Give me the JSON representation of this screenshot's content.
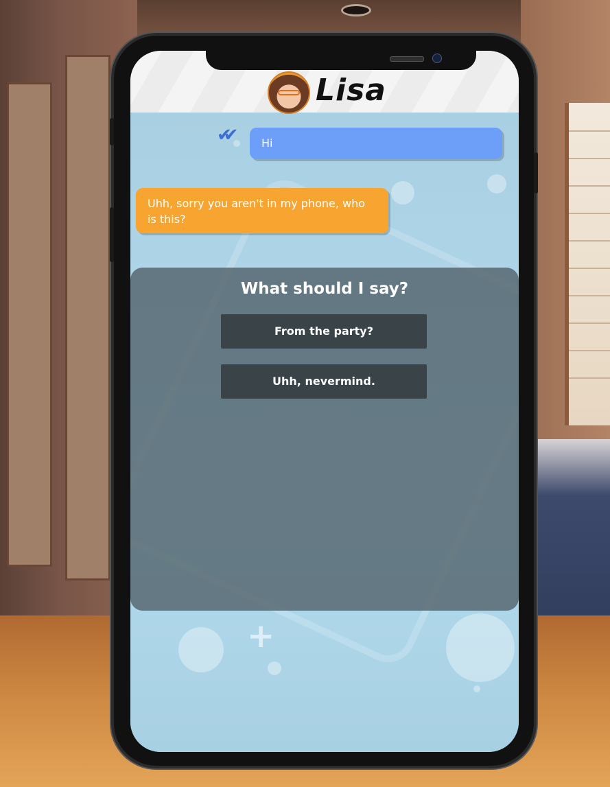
{
  "contact": {
    "name": "Lisa"
  },
  "messages": [
    {
      "from": "player",
      "text": "Hi",
      "status": "read"
    },
    {
      "from": "contact",
      "text": "Uhh, sorry you aren't in my phone, who is this?"
    }
  ],
  "choices": {
    "prompt": "What should I say?",
    "options": [
      "From the party?",
      "Uhh, nevermind."
    ]
  },
  "icons": {
    "read_receipt": "double-check-icon",
    "avatar": "lisa-avatar"
  },
  "colors": {
    "outgoing_bubble": "#6d9ef8",
    "incoming_bubble": "#f7a530",
    "choice_panel": "#46545c",
    "choice_button": "#3a4348",
    "read_receipt": "#3b6fd6"
  }
}
